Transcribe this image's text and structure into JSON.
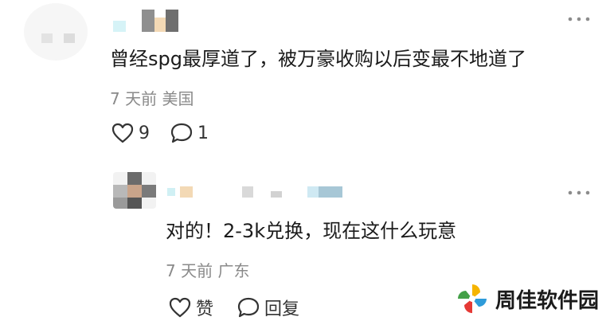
{
  "comments": [
    {
      "text": "曾经spg最厚道了，被万豪收购以后变最不地道了",
      "meta": "7 天前 美国",
      "like_count": "9",
      "reply_count": "1",
      "more": "⋮"
    }
  ],
  "reply": {
    "text": "对的！2-3k兑换，现在这什么玩意",
    "meta": "7 天前 广东",
    "like_label": "赞",
    "reply_label": "回复",
    "more": "⋮"
  },
  "watermark": {
    "text": "周佳软件园"
  }
}
